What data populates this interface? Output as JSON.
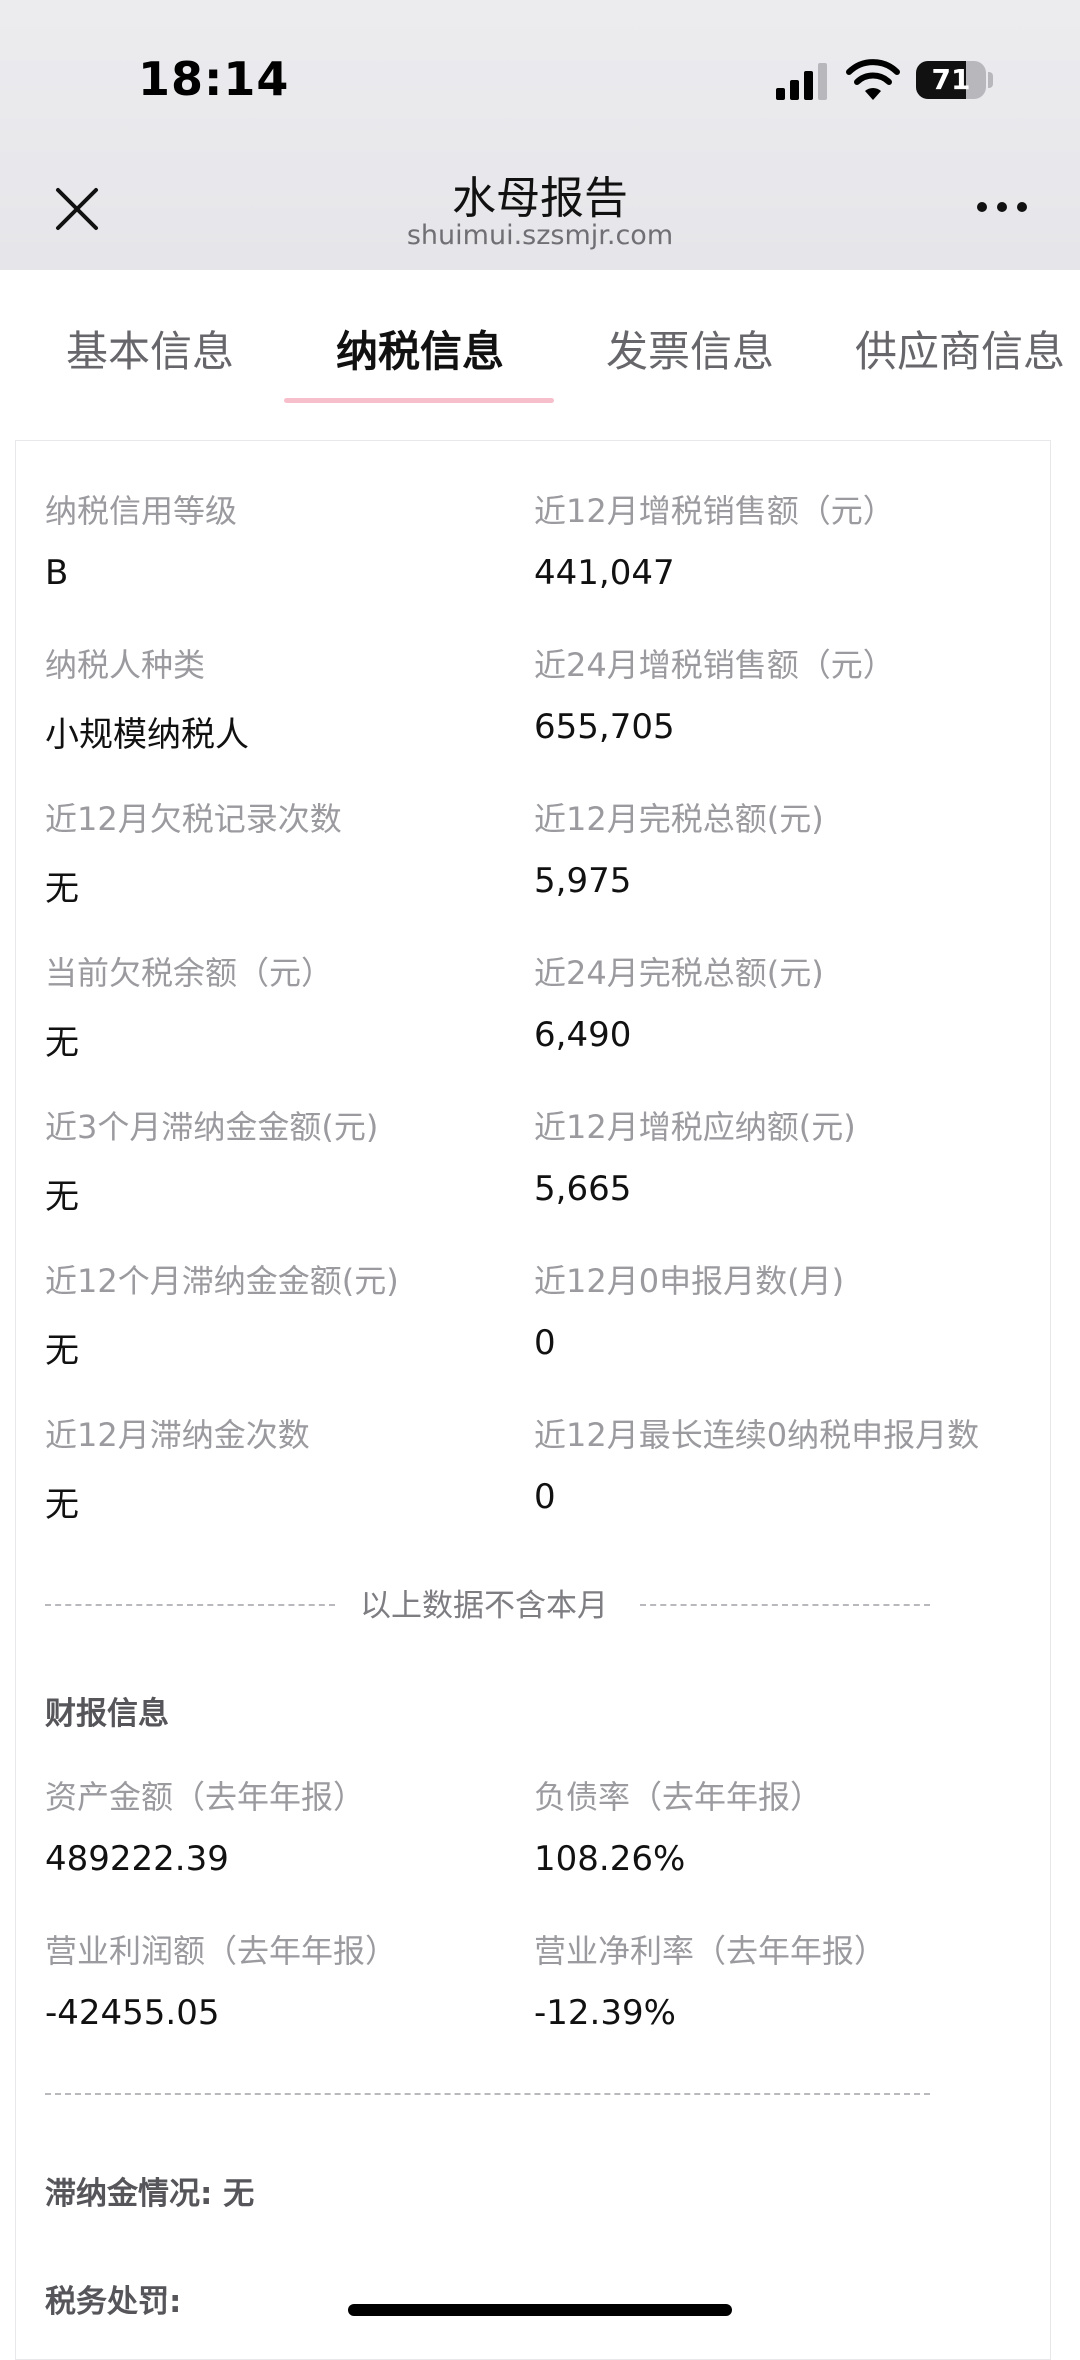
{
  "status_bar": {
    "time": "18:14",
    "battery": "71",
    "battery_level": 0.71
  },
  "title_bar": {
    "title": "水母报告",
    "url": "shuimui.szsmjr.com"
  },
  "tabs": [
    {
      "label": "基本信息",
      "active": false
    },
    {
      "label": "纳税信息",
      "active": true
    },
    {
      "label": "发票信息",
      "active": false
    },
    {
      "label": "供应商信息",
      "active": false
    }
  ],
  "tax_info": [
    {
      "label": "纳税信用等级",
      "value": "B"
    },
    {
      "label": "近12月增税销售额（元）",
      "value": "441,047"
    },
    {
      "label": "纳税人种类",
      "value": "小规模纳税人"
    },
    {
      "label": "近24月增税销售额（元）",
      "value": "655,705"
    },
    {
      "label": "近12月欠税记录次数",
      "value": "无"
    },
    {
      "label": "近12月完税总额(元)",
      "value": "5,975"
    },
    {
      "label": "当前欠税余额（元）",
      "value": "无"
    },
    {
      "label": "近24月完税总额(元)",
      "value": "6,490"
    },
    {
      "label": "近3个月滞纳金金额(元)",
      "value": "无"
    },
    {
      "label": "近12月增税应纳额(元)",
      "value": "5,665"
    },
    {
      "label": "近12个月滞纳金金额(元)",
      "value": "无"
    },
    {
      "label": "近12月0申报月数(月)",
      "value": "0"
    },
    {
      "label": "近12月滞纳金次数",
      "value": "无"
    },
    {
      "label": "近12月最长连续0纳税申报月数",
      "value": "0"
    }
  ],
  "divider_note": "以上数据不含本月",
  "financial": {
    "title": "财报信息",
    "items": [
      {
        "label": "资产金额（去年年报）",
        "value": "489222.39"
      },
      {
        "label": "负债率（去年年报）",
        "value": "108.26%"
      },
      {
        "label": "营业利润额（去年年报）",
        "value": "-42455.05"
      },
      {
        "label": "营业净利率（去年年报）",
        "value": "-12.39%"
      }
    ]
  },
  "late_fee": "滞纳金情况: 无",
  "tax_penalty": "税务处罚:"
}
